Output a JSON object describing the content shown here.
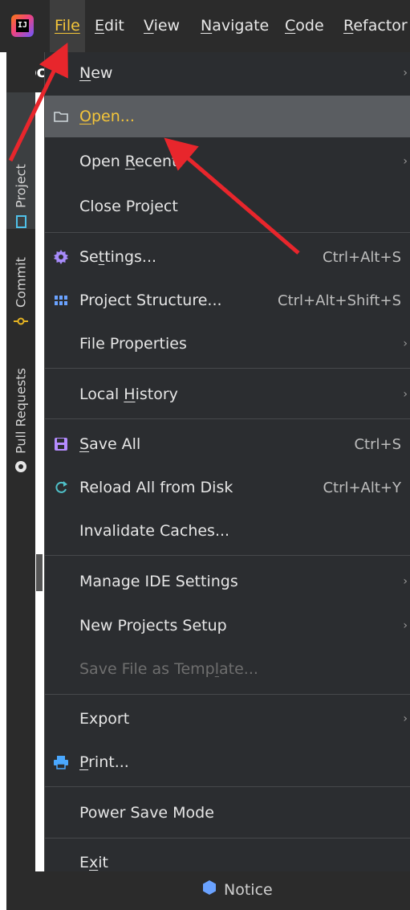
{
  "menubar": {
    "logo_text": "IJ",
    "items": [
      "File",
      "Edit",
      "View",
      "Navigate",
      "Code",
      "Refactor"
    ]
  },
  "toolstripe": {
    "project_label": "Project",
    "commit_label": "Commit",
    "pull_requests_label": "Pull Requests",
    "project_header": "pc"
  },
  "file_menu": {
    "new": "New",
    "open": "Open...",
    "open_recent": "Open Recent",
    "close_project": "Close Project",
    "settings": "Settings...",
    "settings_shortcut": "Ctrl+Alt+S",
    "project_structure": "Project Structure...",
    "project_structure_shortcut": "Ctrl+Alt+Shift+S",
    "file_properties": "File Properties",
    "local_history": "Local History",
    "save_all": "Save All",
    "save_all_shortcut": "Ctrl+S",
    "reload_all": "Reload All from Disk",
    "reload_all_shortcut": "Ctrl+Alt+Y",
    "invalidate_caches": "Invalidate Caches...",
    "manage_ide_settings": "Manage IDE Settings",
    "new_projects_setup": "New Projects Setup",
    "save_as_template": "Save File as Template...",
    "export": "Export",
    "print": "Print...",
    "power_save": "Power Save Mode",
    "exit": "Exit",
    "submenu_arrow": "›"
  },
  "notice": {
    "label": "Notice"
  },
  "colors": {
    "menu_bg": "#2b2d30",
    "selected_bg": "#5a5d61",
    "file_accent": "#f4c53a",
    "annotation_arrow": "#e8262c",
    "settings_icon": "#a78bfa",
    "structure_icon": "#6aa2ff",
    "save_icon": "#b58cff",
    "reload_icon": "#4fc1c9",
    "print_icon": "#4aa8ff"
  }
}
